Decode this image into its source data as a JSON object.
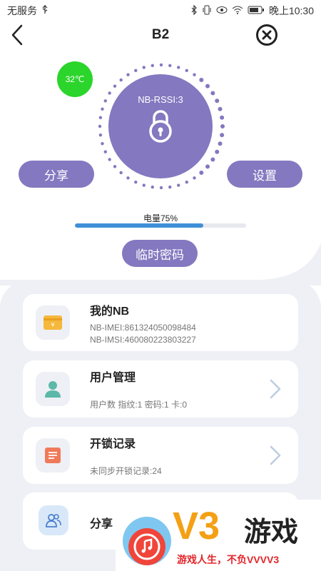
{
  "status_bar": {
    "carrier": "无服务",
    "time": "晚上10:30"
  },
  "header": {
    "title": "B2"
  },
  "device": {
    "temperature": "32℃",
    "rssi": "NB-RSSI:3",
    "share_label": "分享",
    "settings_label": "设置",
    "battery_label": "电量75%",
    "battery_fraction": 0.75,
    "temp_password_label": "临时密码"
  },
  "cards": {
    "my_nb": {
      "title": "我的NB",
      "imei": "NB-IMEI:861324050098484",
      "imsi": "NB-IMSI:460080223803227"
    },
    "user_mgmt": {
      "title": "用户管理",
      "sub": "用户数 指纹:1 密码:1 卡:0"
    },
    "unlock_log": {
      "title": "开锁记录",
      "sub": "未同步开锁记录:24"
    },
    "share": {
      "title": "分享"
    }
  },
  "watermark": {
    "brand": "V3",
    "brand_cn": "游戏",
    "slogan": "游戏人生，不负VVVV3"
  },
  "colors": {
    "accent": "#8478c0",
    "temp_badge": "#2bd52b",
    "battery_fill": "#3f8fd8",
    "card_bg": "#ffffff",
    "page_bg_lower": "#eef0f5"
  },
  "icons": {
    "back": "chevron-left-icon",
    "close": "close-circle-icon",
    "lock": "lock-icon",
    "wallet": "wallet-icon",
    "user": "user-icon",
    "log": "list-icon",
    "share": "users-icon"
  }
}
